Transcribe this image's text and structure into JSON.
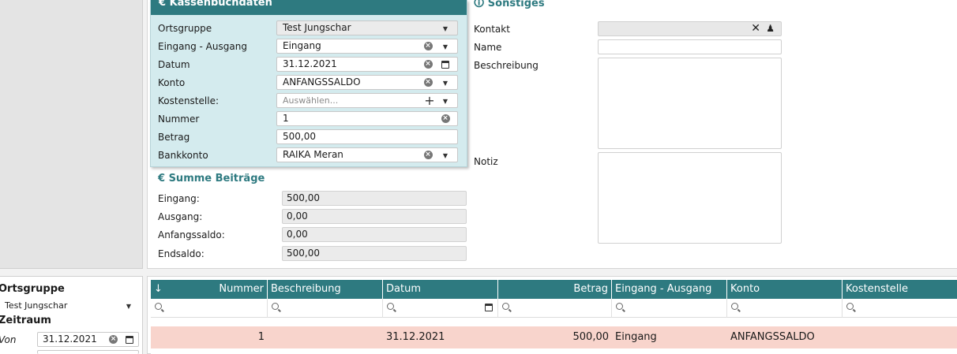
{
  "kasse": {
    "title": "€ Kassenbuchdaten",
    "rows": [
      {
        "label": "Ortsgruppe",
        "value": "Test Jungschar"
      },
      {
        "label": "Eingang - Ausgang",
        "value": "Eingang"
      },
      {
        "label": "Datum",
        "value": "31.12.2021"
      },
      {
        "label": "Konto",
        "value": "ANFANGSSALDO"
      },
      {
        "label": "Kostenstelle:",
        "placeholder": "Auswählen..."
      },
      {
        "label": "Nummer",
        "value": "1"
      },
      {
        "label": "Betrag",
        "value": "500,00"
      },
      {
        "label": "Bankkonto",
        "value": "RAIKA Meran"
      }
    ]
  },
  "summe": {
    "title": "€  Summe Beiträge",
    "rows": [
      {
        "label": "Eingang:",
        "value": "500,00"
      },
      {
        "label": "Ausgang:",
        "value": "0,00"
      },
      {
        "label": "Anfangssaldo:",
        "value": "0,00"
      },
      {
        "label": "Endsaldo:",
        "value": "500,00"
      }
    ]
  },
  "sonstiges": {
    "title": "🛈 Sonstiges",
    "kontakt_label": "Kontakt",
    "name_label": "Name",
    "beschreibung_label": "Beschreibung",
    "notiz_label": "Notiz"
  },
  "filter": {
    "ortsgruppe_title": "Ortsgruppe",
    "ortsgruppe_value": "Test Jungschar",
    "zeitraum_title": "Zeitraum",
    "von_label": "Von",
    "von_value": "31.12.2021"
  },
  "grid": {
    "sort_icon": "↓",
    "columns": [
      "Nummer",
      "Beschreibung",
      "Datum",
      "Betrag",
      "Eingang - Ausgang",
      "Konto",
      "Kostenstelle"
    ],
    "rows": [
      {
        "nummer": "1",
        "beschreibung": "",
        "datum": "31.12.2021",
        "betrag": "500,00",
        "eingang_ausgang": "Eingang",
        "konto": "ANFANGSSALDO",
        "kostenstelle": ""
      }
    ]
  },
  "colors": {
    "accent": "#2e7a80",
    "row_highlight": "#f8d4cc",
    "form_bg": "#d4ebee"
  }
}
